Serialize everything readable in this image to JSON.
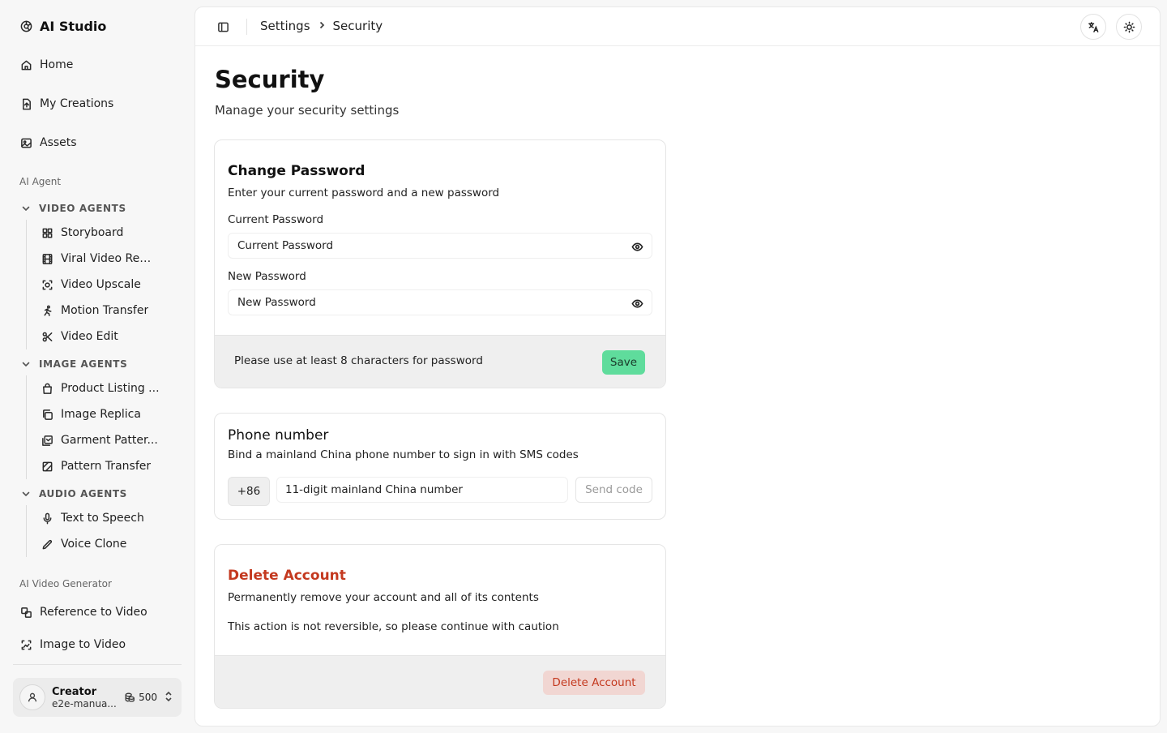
{
  "app": {
    "name": "AI Studio"
  },
  "nav": {
    "top": [
      {
        "label": "Home",
        "icon": "home-icon"
      },
      {
        "label": "My Creations",
        "icon": "file-icon"
      },
      {
        "label": "Assets",
        "icon": "image-icon"
      }
    ],
    "group_agent": "AI Agent",
    "video_agents": {
      "title": "VIDEO AGENTS",
      "items": [
        "Storyboard",
        "Viral Video Rem...",
        "Video Upscale",
        "Motion Transfer",
        "Video Edit"
      ]
    },
    "image_agents": {
      "title": "IMAGE AGENTS",
      "items": [
        "Product Listing ...",
        "Image Replica",
        "Garment Patter...",
        "Pattern Transfer"
      ]
    },
    "audio_agents": {
      "title": "AUDIO AGENTS",
      "items": [
        "Text to Speech",
        "Voice Clone"
      ]
    },
    "group_generator": "AI Video Generator",
    "generator_items": [
      "Reference to Video",
      "Image to Video"
    ]
  },
  "user": {
    "name": "Creator",
    "email": "e2e-manua...",
    "credits": "500"
  },
  "breadcrumb": {
    "parent": "Settings",
    "current": "Security"
  },
  "page": {
    "title": "Security",
    "subtitle": "Manage your security settings"
  },
  "password_card": {
    "title": "Change Password",
    "description": "Enter your current password and a new password",
    "current_label": "Current Password",
    "current_placeholder": "Current Password",
    "new_label": "New Password",
    "new_placeholder": "New Password",
    "hint": "Please use at least 8 characters for password",
    "save_label": "Save"
  },
  "phone_card": {
    "title": "Phone number",
    "description": "Bind a mainland China phone number to sign in with SMS codes",
    "prefix": "+86",
    "placeholder": "11-digit mainland China number",
    "send_label": "Send code"
  },
  "delete_card": {
    "title": "Delete Account",
    "description": "Permanently remove your account and all of its contents",
    "warning": "This action is not reversible, so please continue with caution",
    "button_label": "Delete Account"
  },
  "colors": {
    "save": "#5fdc9c",
    "danger": "#c4391f",
    "danger_bg": "#f1d6d2"
  }
}
